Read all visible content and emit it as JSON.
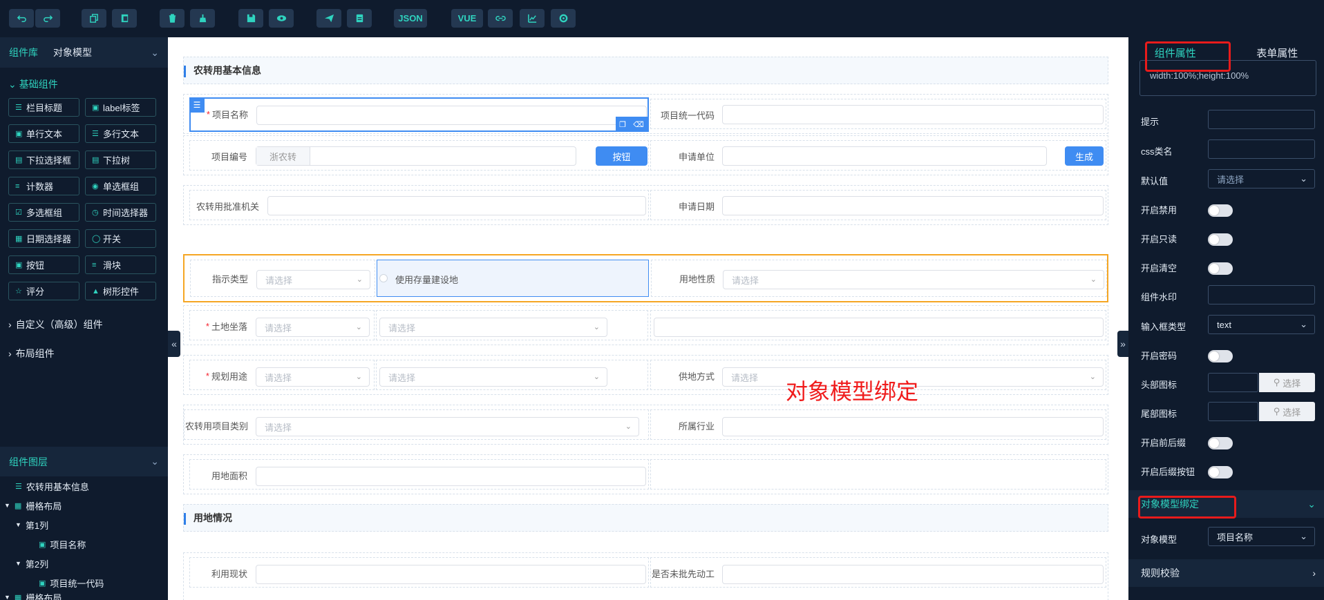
{
  "toolbar": {
    "json": "JSON",
    "vue": "VUE"
  },
  "left": {
    "tab_library": "组件库",
    "tab_model": "对象模型",
    "section_basic": "基础组件",
    "components": [
      [
        "栏目标题",
        "label标签"
      ],
      [
        "单行文本",
        "多行文本"
      ],
      [
        "下拉选择框",
        "下拉树"
      ],
      [
        "计数器",
        "单选框组"
      ],
      [
        "多选框组",
        "时间选择器"
      ],
      [
        "日期选择器",
        "开关"
      ],
      [
        "按钮",
        "滑块"
      ],
      [
        "评分",
        "树形控件"
      ]
    ],
    "group_custom": "自定义（高级）组件",
    "group_layout": "布局组件"
  },
  "layers": {
    "title": "组件图层",
    "items": [
      "农转用基本信息",
      "栅格布局",
      "第1列",
      "项目名称",
      "第2列",
      "项目统一代码",
      "栅格布局"
    ]
  },
  "form": {
    "section1": "农转用基本信息",
    "project_name": "项目名称",
    "unified_code": "项目统一代码",
    "project_no": "项目编号",
    "prefix": "浙农转",
    "btn": "按钮",
    "apply_unit": "申请单位",
    "generate": "生成",
    "approval_org": "农转用批准机关",
    "apply_date": "申请日期",
    "indicator_type": "指示类型",
    "select_ph": "请选择",
    "use_stock": "使用存量建设地",
    "land_nature": "用地性质",
    "land_location": "土地坐落",
    "plan_use": "规划用途",
    "supply_mode": "供地方式",
    "project_category": "农转用项目类别",
    "industry": "所属行业",
    "land_area": "用地面积",
    "section2": "用地情况",
    "current_use": "利用现状",
    "unapproved_build": "是否未批先动工"
  },
  "annotation": "对象模型绑定",
  "right": {
    "tab_component": "组件属性",
    "tab_form": "表单属性",
    "textarea_text": "width:100%;height:100%",
    "hint": "提示",
    "css": "css类名",
    "default": "默认值",
    "default_ph": "请选择",
    "disabled": "开启禁用",
    "readonly": "开启只读",
    "clearable": "开启清空",
    "watermark": "组件水印",
    "input_type": "输入框类型",
    "input_type_val": "text",
    "password": "开启密码",
    "head_icon": "头部图标",
    "tail_icon": "尾部图标",
    "choose": "选择",
    "prefix_suffix": "开启前后缀",
    "suffix_btn": "开启后缀按钮",
    "binding": "对象模型绑定",
    "model": "对象模型",
    "model_val": "项目名称",
    "rules": "规则校验"
  }
}
